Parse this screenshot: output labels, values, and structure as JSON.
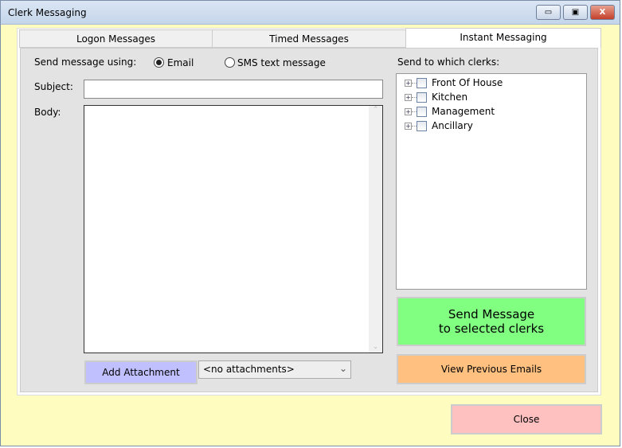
{
  "window": {
    "title": "Clerk Messaging",
    "minimize": "▭",
    "maximize": "▣",
    "close": "X"
  },
  "tabs": [
    {
      "label": "Logon Messages"
    },
    {
      "label": "Timed Messages"
    },
    {
      "label": "Instant Messaging"
    }
  ],
  "form": {
    "send_using_label": "Send message using:",
    "option_email": "Email",
    "option_sms": "SMS text message",
    "selected": "Email",
    "subject_label": "Subject:",
    "subject_value": "",
    "body_label": "Body:",
    "body_value": "",
    "add_attachment": "Add Attachment",
    "attachments_value": "<no attachments>"
  },
  "clerks": {
    "label": "Send to which clerks:",
    "groups": [
      {
        "label": "Front Of House"
      },
      {
        "label": "Kitchen"
      },
      {
        "label": "Management"
      },
      {
        "label": "Ancillary"
      }
    ]
  },
  "buttons": {
    "send_line1": "Send Message",
    "send_line2": "to selected clerks",
    "view_previous": "View Previous Emails",
    "close": "Close"
  },
  "colors": {
    "send": "#80ff80",
    "view": "#ffc080",
    "close": "#ffc0c0",
    "attach": "#c0c0ff"
  }
}
